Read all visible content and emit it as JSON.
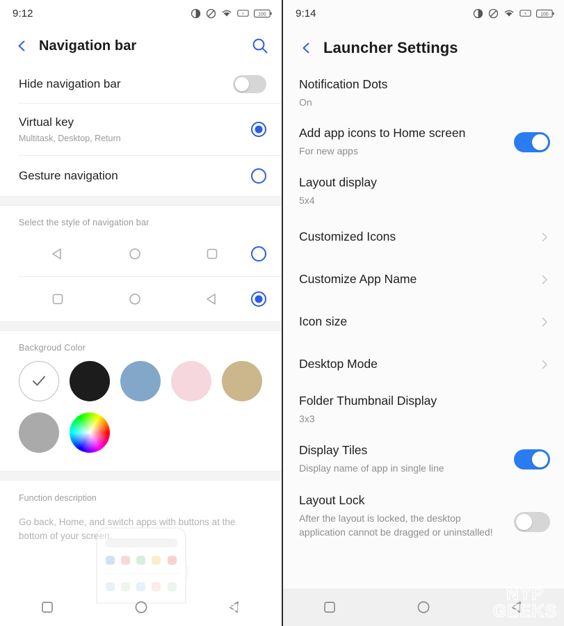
{
  "left_screen": {
    "status": {
      "time": "9:12",
      "icons": [
        "contrast-icon",
        "do-not-disturb-icon",
        "wifi-icon",
        "sim-off-icon",
        "battery-icon"
      ],
      "battery_level": "100"
    },
    "title": "Navigation bar",
    "back_icon": "back-chevron-icon",
    "search_icon": "search-icon",
    "rows": [
      {
        "title": "Hide navigation bar",
        "sub": "",
        "control": "switch",
        "value": "off"
      },
      {
        "title": "Virtual key",
        "sub": "Multitask, Desktop, Return",
        "control": "radio",
        "value": "checked"
      },
      {
        "title": "Gesture navigation",
        "sub": "",
        "control": "radio",
        "value": "unchecked"
      }
    ],
    "style_section": {
      "label": "Select the style of navigation bar",
      "options": [
        {
          "glyphs": [
            "back-triangle-icon",
            "home-circle-icon",
            "recents-square-icon"
          ],
          "selected": false
        },
        {
          "glyphs": [
            "recents-square-icon",
            "home-circle-icon",
            "back-triangle-icon"
          ],
          "selected": true
        }
      ]
    },
    "background_color": {
      "label": "Backgroud Color",
      "swatches": [
        {
          "name": "white",
          "color": "#ffffff",
          "selected": true
        },
        {
          "name": "black",
          "color": "#1c1c1c",
          "selected": false
        },
        {
          "name": "steel-blue",
          "color": "#83a7c9",
          "selected": false
        },
        {
          "name": "pink",
          "color": "#f5d7dd",
          "selected": false
        },
        {
          "name": "khaki",
          "color": "#ccb68c",
          "selected": false
        },
        {
          "name": "gray",
          "color": "#aaaaaa",
          "selected": false
        },
        {
          "name": "color-wheel",
          "color": "wheel",
          "selected": false
        }
      ]
    },
    "function_description": {
      "label": "Function description",
      "text": "Go back, Home, and switch apps with buttons at the bottom of your screen."
    },
    "illustration_icon_colors": [
      "#9dc0e8",
      "#f0a9a5",
      "#a8ddb5",
      "#f6dd8f",
      "#f09b95"
    ],
    "sysnav": [
      "recents-square-icon",
      "home-circle-icon",
      "back-triangle-icon"
    ]
  },
  "right_screen": {
    "status": {
      "time": "9:14",
      "icons": [
        "contrast-icon",
        "do-not-disturb-icon",
        "wifi-icon",
        "sim-off-icon",
        "battery-icon"
      ],
      "battery_level": "100"
    },
    "title": "Launcher Settings",
    "back_icon": "back-chevron-icon",
    "rows": [
      {
        "title": "Notification Dots",
        "sub": "On",
        "control": "none"
      },
      {
        "title": "Add app icons to Home screen",
        "sub": "For new apps",
        "control": "switch",
        "value": "on"
      },
      {
        "title": "Layout display",
        "sub": "5x4",
        "control": "none"
      },
      {
        "title": "Customized Icons",
        "sub": "",
        "control": "chevron"
      },
      {
        "title": "Customize App Name",
        "sub": "",
        "control": "chevron"
      },
      {
        "title": "Icon size",
        "sub": "",
        "control": "chevron"
      },
      {
        "title": "Desktop Mode",
        "sub": "",
        "control": "chevron"
      },
      {
        "title": "Folder Thumbnail Display",
        "sub": "3x3",
        "control": "none"
      },
      {
        "title": "Display Tiles",
        "sub": "Display name of app in single line",
        "control": "switch",
        "value": "on"
      },
      {
        "title": "Layout Lock",
        "sub": "After the layout is locked, the desktop application cannot be dragged or uninstalled!",
        "control": "switch",
        "value": "off"
      }
    ],
    "sysnav": [
      "recents-square-icon",
      "home-circle-icon",
      "back-triangle-icon"
    ]
  },
  "watermark": {
    "line1": "NYP",
    "line2": "GEEKS"
  },
  "colors": {
    "accent_blue": "#2b5ce8",
    "switch_on": "#2b7cf0",
    "switch_off": "#d6d6d6",
    "text_primary": "#1d1d1d",
    "text_secondary": "#8e8e8e"
  }
}
